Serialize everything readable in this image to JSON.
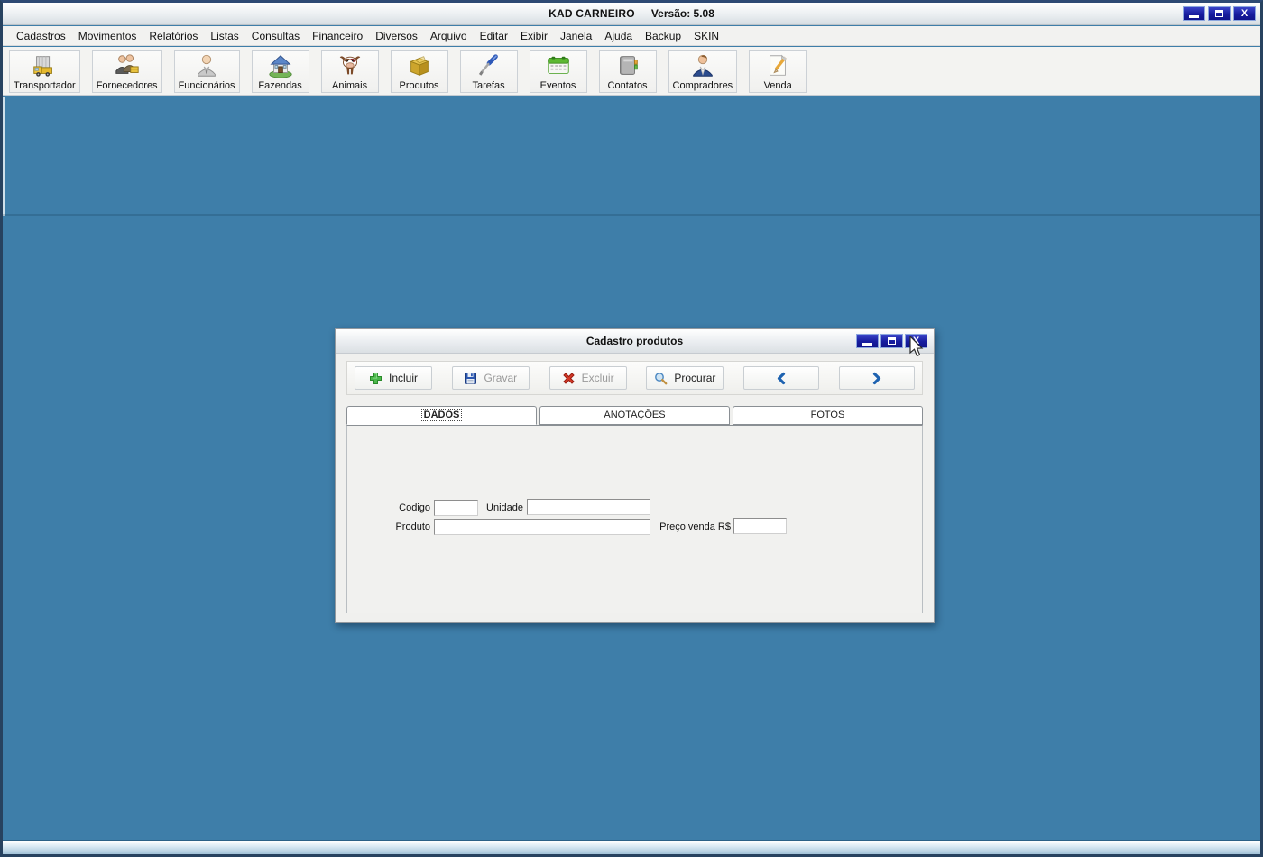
{
  "app_window": {
    "title": "KAD CARNEIRO",
    "version": "Versão: 5.08"
  },
  "menubar": {
    "items": [
      {
        "label": "Cadastros"
      },
      {
        "label": "Movimentos"
      },
      {
        "label": "Relatórios"
      },
      {
        "label": "Listas"
      },
      {
        "label": "Consultas"
      },
      {
        "label": "Financeiro"
      },
      {
        "label": "Diversos"
      },
      {
        "label": "Arquivo",
        "underline": 0
      },
      {
        "label": "Editar",
        "underline": 0
      },
      {
        "label": "Exibir",
        "underline": 1
      },
      {
        "label": "Janela",
        "underline": 0
      },
      {
        "label": "Ajuda"
      },
      {
        "label": "Backup"
      },
      {
        "label": "SKIN"
      }
    ]
  },
  "toolbar": {
    "buttons": [
      {
        "label": "Transportador",
        "icon": "truck-icon"
      },
      {
        "label": "Fornecedores",
        "icon": "suppliers-icon"
      },
      {
        "label": "Funcionários",
        "icon": "employee-icon"
      },
      {
        "label": "Fazendas",
        "icon": "farm-house-icon"
      },
      {
        "label": "Animais",
        "icon": "cow-icon"
      },
      {
        "label": "Produtos",
        "icon": "product-box-icon"
      },
      {
        "label": "Tarefas",
        "icon": "screwdriver-icon"
      },
      {
        "label": "Eventos",
        "icon": "calendar-icon"
      },
      {
        "label": "Contatos",
        "icon": "address-book-icon"
      },
      {
        "label": "Compradores",
        "icon": "buyer-icon"
      },
      {
        "label": "Venda",
        "icon": "pencil-note-icon"
      }
    ]
  },
  "dialog": {
    "title": "Cadastro produtos",
    "toolbar": {
      "incluir": {
        "label": "Incluir",
        "enabled": true
      },
      "gravar": {
        "label": "Gravar",
        "enabled": false
      },
      "excluir": {
        "label": "Excluir",
        "enabled": false
      },
      "procurar": {
        "label": "Procurar",
        "enabled": true
      }
    },
    "tabs": [
      {
        "label": "DADOS",
        "active": true
      },
      {
        "label": "ANOTAÇÕES",
        "active": false
      },
      {
        "label": "FOTOS",
        "active": false
      }
    ],
    "form": {
      "codigo_label": "Codigo",
      "codigo_value": "",
      "unidade_label": "Unidade",
      "unidade_value": "",
      "produto_label": "Produto",
      "produto_value": "",
      "preco_label": "Preço venda R$",
      "preco_value": ""
    }
  },
  "colors": {
    "desktop": "#3E7EA9",
    "control_button_blue": "#171C9E",
    "accent_blue": "#1E62B0",
    "disabled_text": "#9A9A9A"
  }
}
